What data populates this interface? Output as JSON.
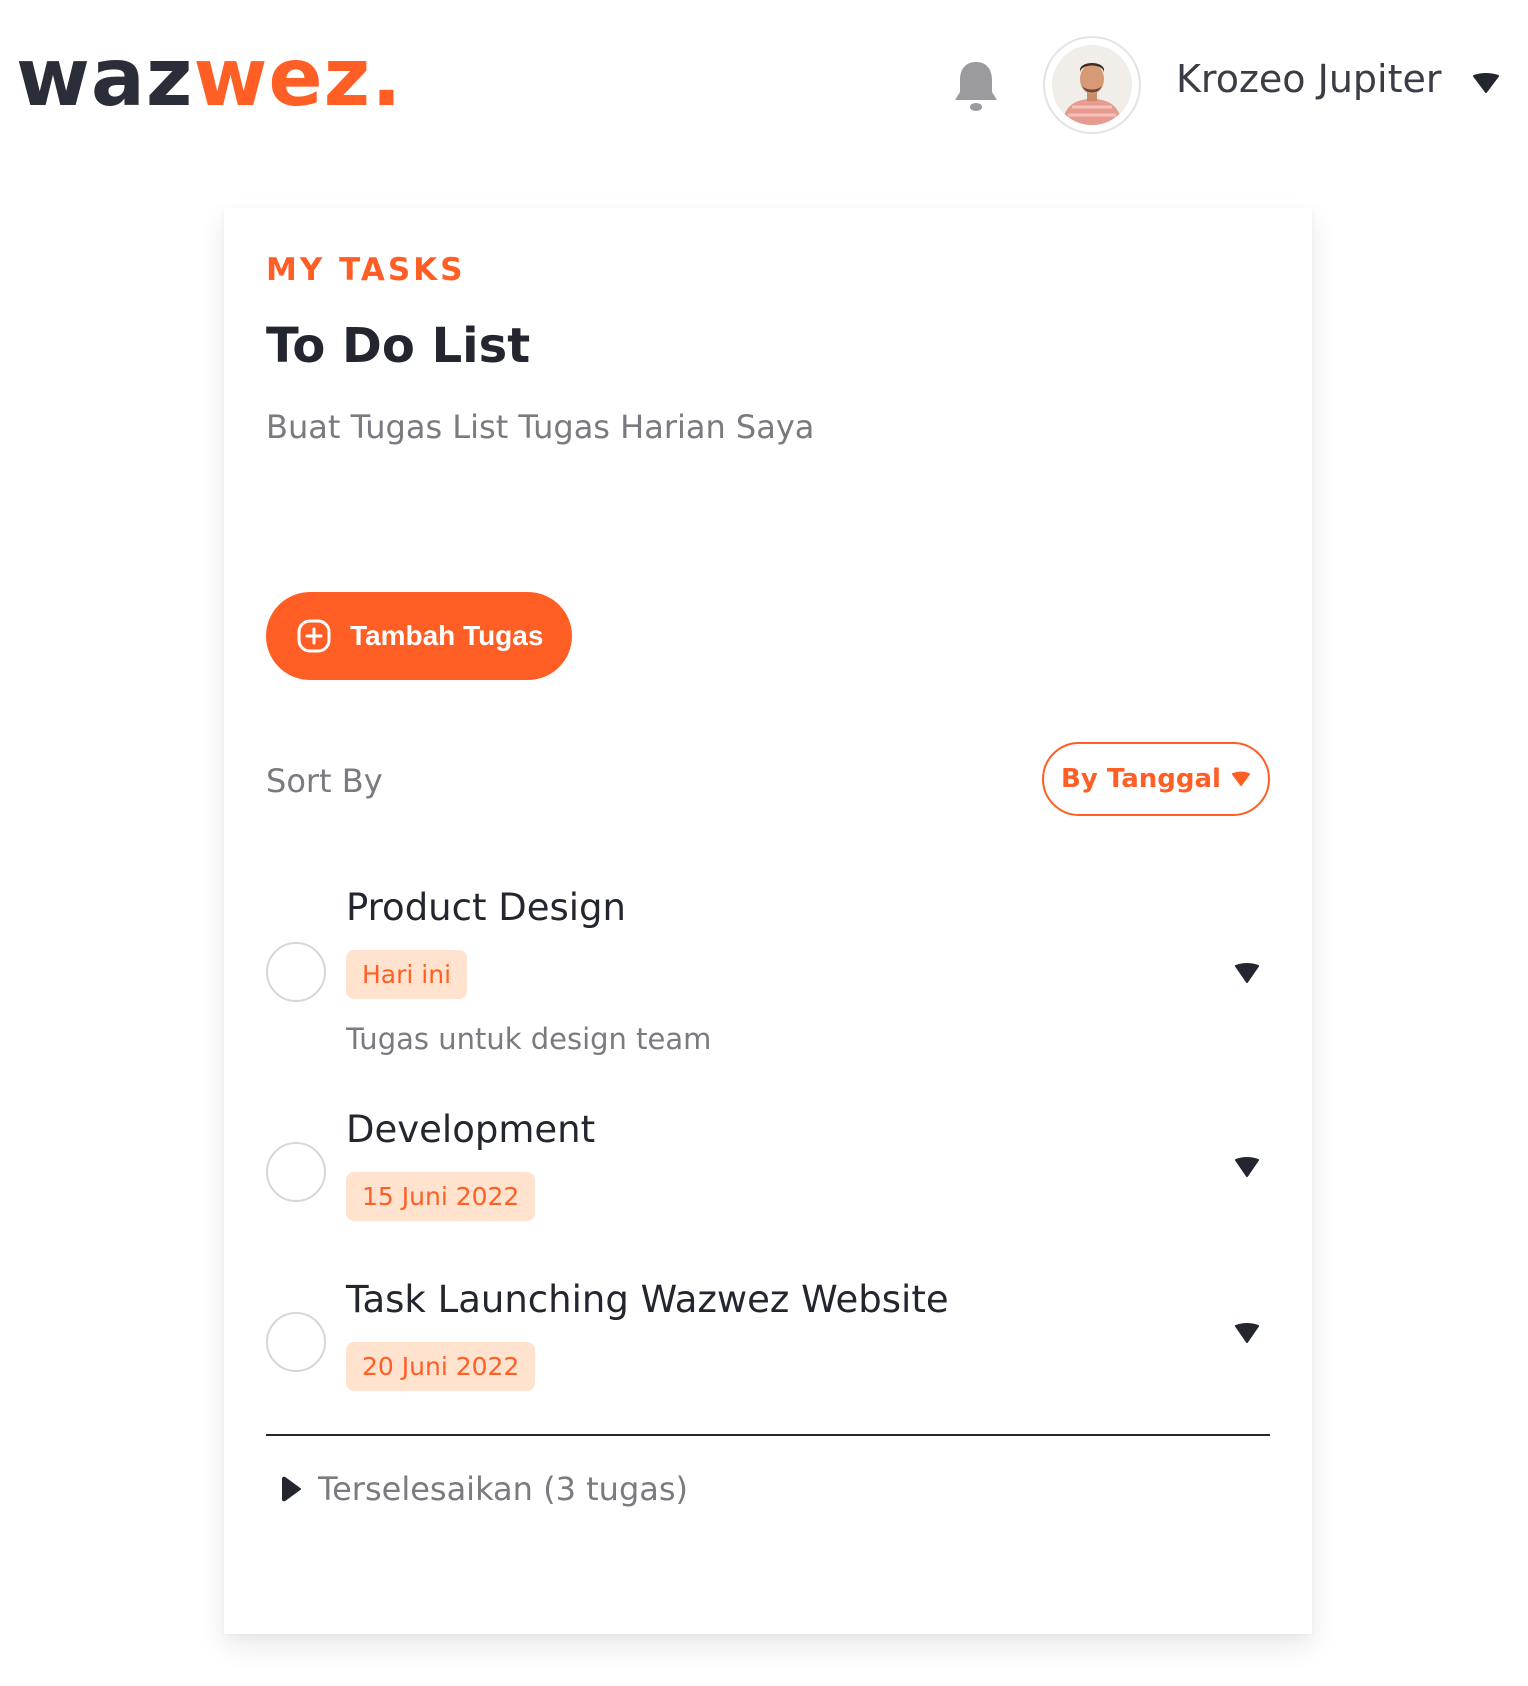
{
  "header": {
    "logo_dark": "waz",
    "logo_accent": "wez",
    "logo_dot": ".",
    "user_name": "Krozeo Jupiter"
  },
  "card": {
    "eyebrow": "MY TASKS",
    "title": "To Do List",
    "subtitle": "Buat Tugas List Tugas Harian Saya",
    "add_button_label": "Tambah Tugas",
    "sort_label": "Sort By",
    "sort_value": "By Tanggal",
    "tasks": [
      {
        "title": "Product Design",
        "tag": "Hari ini",
        "description": "Tugas untuk design team"
      },
      {
        "title": "Development",
        "tag": "15 Juni 2022"
      },
      {
        "title": "Task Launching Wazwez Website",
        "tag": "20 Juni 2022"
      }
    ],
    "completed_label": "Terselesaikan (3 tugas)"
  },
  "icons": {
    "notification": "bell-icon",
    "user_menu": "caret-down-icon",
    "add": "plus-circle-icon",
    "sort": "caret-down-icon",
    "task_expand": "caret-down-icon",
    "completed_toggle": "play-icon"
  },
  "colors": {
    "accent": "#ff5e24",
    "tag_bg": "#ffe3cf",
    "text_dark": "#23252f",
    "text_muted": "#7a7a80"
  }
}
